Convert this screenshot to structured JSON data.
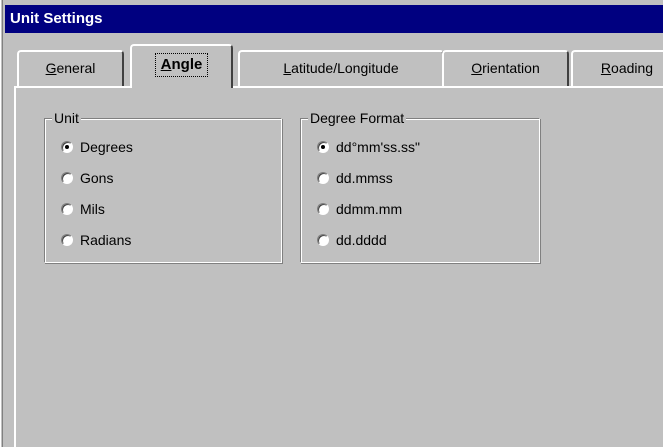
{
  "window": {
    "title": "Unit Settings"
  },
  "tabs": [
    {
      "label": "General",
      "active": false
    },
    {
      "label": "Angle",
      "active": true
    },
    {
      "label": "Latitude/Longitude",
      "active": false
    },
    {
      "label": "Orientation",
      "active": false
    },
    {
      "label": "Roading",
      "active": false
    }
  ],
  "unit_group": {
    "legend": "Unit",
    "options": [
      {
        "label": "Degrees",
        "checked": true
      },
      {
        "label": "Gons",
        "checked": false
      },
      {
        "label": "Mils",
        "checked": false
      },
      {
        "label": "Radians",
        "checked": false
      }
    ]
  },
  "degree_format_group": {
    "legend": "Degree Format",
    "options": [
      {
        "label": "dd°mm'ss.ss\"",
        "checked": true
      },
      {
        "label": "dd.mmss",
        "checked": false
      },
      {
        "label": "ddmm.mm",
        "checked": false
      },
      {
        "label": "dd.dddd",
        "checked": false
      }
    ]
  },
  "colors": {
    "titlebar": "#000080",
    "face": "#c0c0c0"
  }
}
